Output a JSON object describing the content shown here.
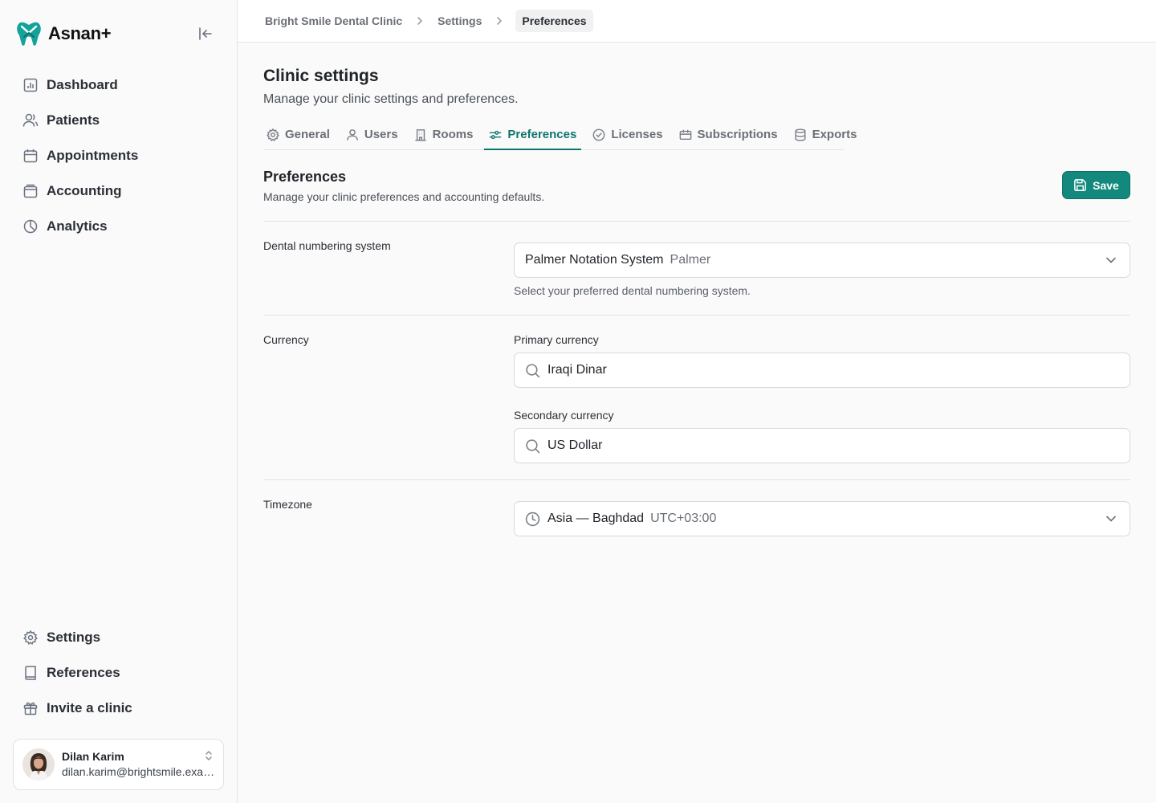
{
  "app": {
    "name": "Asnan+"
  },
  "sidebar": {
    "top_items": [
      {
        "label": "Dashboard",
        "icon": "chart-bar-icon"
      },
      {
        "label": "Patients",
        "icon": "users-icon"
      },
      {
        "label": "Appointments",
        "icon": "calendar-icon"
      },
      {
        "label": "Accounting",
        "icon": "wallet-icon"
      },
      {
        "label": "Analytics",
        "icon": "pie-chart-icon"
      }
    ],
    "bottom_items": [
      {
        "label": "Settings",
        "icon": "gear-icon"
      },
      {
        "label": "References",
        "icon": "book-icon"
      },
      {
        "label": "Invite a clinic",
        "icon": "gift-icon"
      }
    ],
    "user": {
      "name": "Dilan Karim",
      "email": "dilan.karim@brightsmile.example"
    }
  },
  "breadcrumb": {
    "items": [
      "Bright Smile Dental Clinic",
      "Settings",
      "Preferences"
    ]
  },
  "page": {
    "title": "Clinic settings",
    "subtitle": "Manage your clinic settings and preferences."
  },
  "tabs": [
    {
      "label": "General",
      "icon": "gear-icon"
    },
    {
      "label": "Users",
      "icon": "users-icon"
    },
    {
      "label": "Rooms",
      "icon": "building-icon"
    },
    {
      "label": "Preferences",
      "icon": "sliders-icon",
      "active": true
    },
    {
      "label": "Licenses",
      "icon": "badge-check-icon"
    },
    {
      "label": "Subscriptions",
      "icon": "ticket-icon"
    },
    {
      "label": "Exports",
      "icon": "database-icon"
    }
  ],
  "section": {
    "title": "Preferences",
    "subtitle": "Manage your clinic preferences and accounting defaults.",
    "save_label": "Save"
  },
  "numbering": {
    "label": "Dental numbering system",
    "value": "Palmer Notation System",
    "value_short": "Palmer",
    "help": "Select your preferred dental numbering system."
  },
  "currency": {
    "label": "Currency",
    "primary_label": "Primary currency",
    "primary_value": "Iraqi Dinar",
    "secondary_label": "Secondary currency",
    "secondary_value": "US Dollar"
  },
  "timezone": {
    "label": "Timezone",
    "value": "Asia — Baghdad",
    "offset": "UTC+03:00"
  },
  "colors": {
    "accent": "#12897c",
    "accent_dark": "#0f766e",
    "brand": "#14a39a"
  }
}
